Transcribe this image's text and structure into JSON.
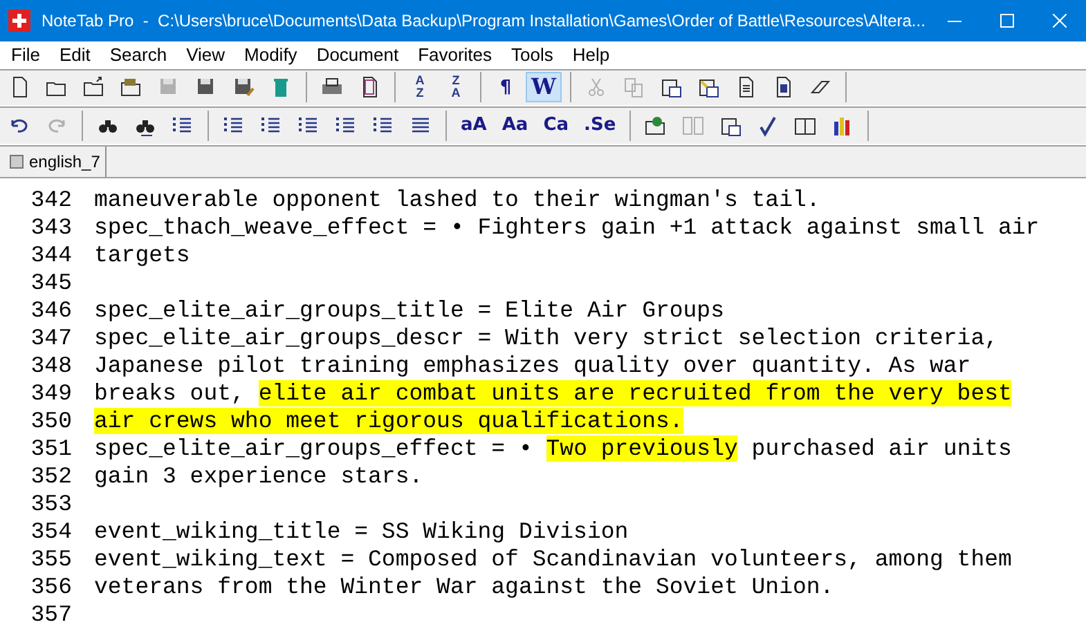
{
  "window": {
    "title": "NoteTab Pro  -  C:\\Users\\bruce\\Documents\\Data Backup\\Program Installation\\Games\\Order of Battle\\Resources\\Altera..."
  },
  "menu": [
    "File",
    "Edit",
    "Search",
    "View",
    "Modify",
    "Document",
    "Favorites",
    "Tools",
    "Help"
  ],
  "toolbars": [
    [
      {
        "kind": "new",
        "disabled": false,
        "selected": false
      },
      {
        "kind": "open",
        "disabled": false,
        "selected": false
      },
      {
        "kind": "reopen",
        "disabled": false,
        "selected": false
      },
      {
        "kind": "openmany",
        "disabled": false,
        "selected": false
      },
      {
        "kind": "save",
        "disabled": true,
        "selected": false
      },
      {
        "kind": "saveall",
        "disabled": false,
        "selected": false
      },
      {
        "kind": "saveas",
        "disabled": false,
        "selected": false
      },
      {
        "kind": "trash",
        "disabled": false,
        "selected": false
      },
      {
        "kind": "sep"
      },
      {
        "kind": "print",
        "disabled": false,
        "selected": false
      },
      {
        "kind": "preview",
        "disabled": false,
        "selected": false
      },
      {
        "kind": "sep"
      },
      {
        "kind": "sort",
        "top": "A",
        "bottom": "Z",
        "disabled": false,
        "selected": false
      },
      {
        "kind": "sort",
        "top": "Z",
        "bottom": "A",
        "disabled": false,
        "selected": false
      },
      {
        "kind": "sep"
      },
      {
        "kind": "text",
        "label": "¶",
        "disabled": false,
        "selected": false
      },
      {
        "kind": "text",
        "label": "W",
        "disabled": false,
        "selected": true
      },
      {
        "kind": "sep"
      },
      {
        "kind": "cut",
        "disabled": true,
        "selected": false
      },
      {
        "kind": "copy",
        "disabled": true,
        "selected": false
      },
      {
        "kind": "paste",
        "disabled": false,
        "selected": false
      },
      {
        "kind": "pastespecial",
        "disabled": false,
        "selected": false
      },
      {
        "kind": "doc",
        "disabled": false,
        "selected": false
      },
      {
        "kind": "docblue",
        "disabled": false,
        "selected": false
      },
      {
        "kind": "eraser",
        "disabled": false,
        "selected": false
      },
      {
        "kind": "sep"
      }
    ],
    [
      {
        "kind": "undo",
        "disabled": false,
        "selected": false
      },
      {
        "kind": "redo",
        "disabled": true,
        "selected": false
      },
      {
        "kind": "sep"
      },
      {
        "kind": "find",
        "disabled": false,
        "selected": false
      },
      {
        "kind": "replace",
        "disabled": false,
        "selected": false
      },
      {
        "kind": "wrap",
        "disabled": false,
        "selected": false
      },
      {
        "kind": "sep"
      },
      {
        "kind": "bullets",
        "disabled": false,
        "selected": false
      },
      {
        "kind": "numbers",
        "disabled": false,
        "selected": false
      },
      {
        "kind": "indent",
        "disabled": false,
        "selected": false
      },
      {
        "kind": "outdent",
        "disabled": false,
        "selected": false
      },
      {
        "kind": "spacing",
        "disabled": false,
        "selected": false
      },
      {
        "kind": "justify",
        "disabled": false,
        "selected": false
      },
      {
        "kind": "sep"
      },
      {
        "kind": "case",
        "label": "aA",
        "disabled": false,
        "selected": false
      },
      {
        "kind": "case",
        "label": "Aa",
        "disabled": false,
        "selected": false
      },
      {
        "kind": "text",
        "label": "Ca",
        "disabled": false,
        "selected": false
      },
      {
        "kind": "text",
        "label": ".Se",
        "disabled": false,
        "selected": false
      },
      {
        "kind": "sep"
      },
      {
        "kind": "webfolder",
        "disabled": false,
        "selected": false
      },
      {
        "kind": "columns",
        "disabled": true,
        "selected": false
      },
      {
        "kind": "clipboard",
        "disabled": false,
        "selected": false
      },
      {
        "kind": "spell",
        "disabled": false,
        "selected": false
      },
      {
        "kind": "book",
        "disabled": false,
        "selected": false
      },
      {
        "kind": "chart",
        "disabled": false,
        "selected": false
      },
      {
        "kind": "sep"
      }
    ]
  ],
  "tabs": [
    {
      "label": "english_7",
      "selected": true
    }
  ],
  "lines": [
    {
      "number": "342",
      "segments": [
        {
          "text": "maneuverable opponent lashed to their wingman's tail.",
          "highlighted": false
        }
      ]
    },
    {
      "number": "343",
      "segments": [
        {
          "text": "spec_thach_weave_effect = • Fighters gain +1 attack against small air",
          "highlighted": false
        }
      ]
    },
    {
      "number": "344",
      "segments": [
        {
          "text": "targets",
          "highlighted": false
        }
      ]
    },
    {
      "number": "345"
    },
    {
      "number": "346",
      "segments": [
        {
          "text": "spec_elite_air_groups_title = Elite Air Groups",
          "highlighted": false
        }
      ]
    },
    {
      "number": "347",
      "segments": [
        {
          "text": "spec_elite_air_groups_descr = With very strict selection criteria,",
          "highlighted": false
        }
      ]
    },
    {
      "number": "348",
      "segments": [
        {
          "text": "Japanese pilot training emphasizes quality over quantity. As war",
          "highlighted": false
        }
      ]
    },
    {
      "number": "349",
      "segments": [
        {
          "text": "breaks out, ",
          "highlighted": false
        },
        {
          "text": "elite air combat units are recruited from the very best",
          "highlighted": true
        }
      ]
    },
    {
      "number": "350",
      "segments": [
        {
          "text": "air crews who meet rigorous qualifications.",
          "highlighted": true
        }
      ]
    },
    {
      "number": "351",
      "segments": [
        {
          "text": "spec_elite_air_groups_effect = • ",
          "highlighted": false
        },
        {
          "text": "Two previously",
          "highlighted": true
        },
        {
          "text": " purchased air units",
          "highlighted": false
        }
      ]
    },
    {
      "number": "352",
      "segments": [
        {
          "text": "gain 3 experience stars.",
          "highlighted": false
        }
      ]
    },
    {
      "number": "353"
    },
    {
      "number": "354",
      "segments": [
        {
          "text": "event_wiking_title = SS Wiking Division",
          "highlighted": false
        }
      ]
    },
    {
      "number": "355",
      "segments": [
        {
          "text": "event_wiking_text = Composed of Scandinavian volunteers, among them",
          "highlighted": false
        }
      ]
    },
    {
      "number": "356",
      "segments": [
        {
          "text": "veterans from the Winter War against the Soviet Union.",
          "highlighted": false
        }
      ]
    },
    {
      "number": "357"
    }
  ]
}
